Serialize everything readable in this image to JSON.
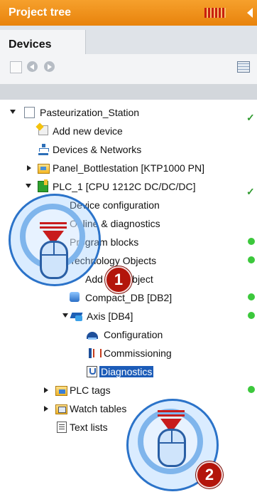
{
  "panel": {
    "title": "Project tree"
  },
  "tabs": [
    {
      "label": "Devices"
    }
  ],
  "tree": {
    "root": {
      "label": "Pasteurization_Station"
    },
    "add_new_device": {
      "label": "Add new device"
    },
    "devices_networks": {
      "label": "Devices & Networks"
    },
    "panel": {
      "label": "Panel_Bottlestation [KTP1000 PN]"
    },
    "plc": {
      "label": "PLC_1 [CPU 1212C DC/DC/DC]"
    },
    "device_configuration": {
      "label": "Device configuration"
    },
    "online_diagnostics": {
      "label": "Online & diagnostics"
    },
    "program_blocks": {
      "label": "Program blocks"
    },
    "technology_objects": {
      "label": "Technology Objects"
    },
    "add_new_object": {
      "label": "Add new object"
    },
    "compact_db": {
      "label": "Compact_DB [DB2]"
    },
    "axis": {
      "label": "Axis [DB4]"
    },
    "configuration": {
      "label": "Configuration"
    },
    "commissioning": {
      "label": "Commissioning"
    },
    "diagnostics": {
      "label": "Diagnostics"
    },
    "plc_tags": {
      "label": "PLC tags"
    },
    "watch_tables": {
      "label": "Watch tables"
    },
    "text_lists": {
      "label": "Text lists"
    }
  },
  "callouts": [
    {
      "number": "1",
      "action": "double-click"
    },
    {
      "number": "2",
      "action": "double-click"
    }
  ],
  "colors": {
    "header": "#e8830c",
    "selection": "#1c5cb8",
    "status_ok": "#3cc83c",
    "callout_badge": "#b3150b"
  }
}
